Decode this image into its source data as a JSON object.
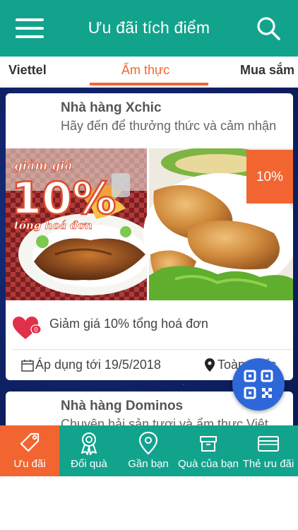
{
  "header": {
    "title": "Ưu đãi tích điểm",
    "menu_icon": "hamburger-icon",
    "search_icon": "search-icon"
  },
  "tabs": [
    {
      "label": "Viettel",
      "active": false
    },
    {
      "label": "Ẩm thực",
      "active": true
    },
    {
      "label": "Mua sắm",
      "active": false
    }
  ],
  "cards": [
    {
      "name": "Nhà hàng Xchic",
      "description": "Hãy đến để thưởng thức và  cảm nhận",
      "banner_text_top": "giảm giá",
      "banner_text_big": "10%",
      "banner_text_bottom": "tổng hoá đơn",
      "discount": "10%",
      "offer": "Giảm giá 10% tổng hoá đơn",
      "like_count": "0",
      "date": "Áp dụng tới 19/5/2018",
      "location": "Toàn quốc"
    },
    {
      "name": "Nhà hàng Dominos",
      "description": "Chuyên hải sản tươi và ẩm thực Việt"
    }
  ],
  "bottom_nav": [
    {
      "label": "Ưu đãi",
      "icon": "tag-icon",
      "active": true
    },
    {
      "label": "Đổi quà",
      "icon": "award-icon",
      "active": false
    },
    {
      "label": "Gần bạn",
      "icon": "map-pin-icon",
      "active": false
    },
    {
      "label": "Quà của bạn",
      "icon": "gift-box-icon",
      "active": false
    },
    {
      "label": "Thẻ ưu đãi",
      "icon": "card-icon",
      "active": false
    }
  ],
  "colors": {
    "primary": "#12a38d",
    "accent": "#f26530",
    "fab": "#2e68d8"
  }
}
